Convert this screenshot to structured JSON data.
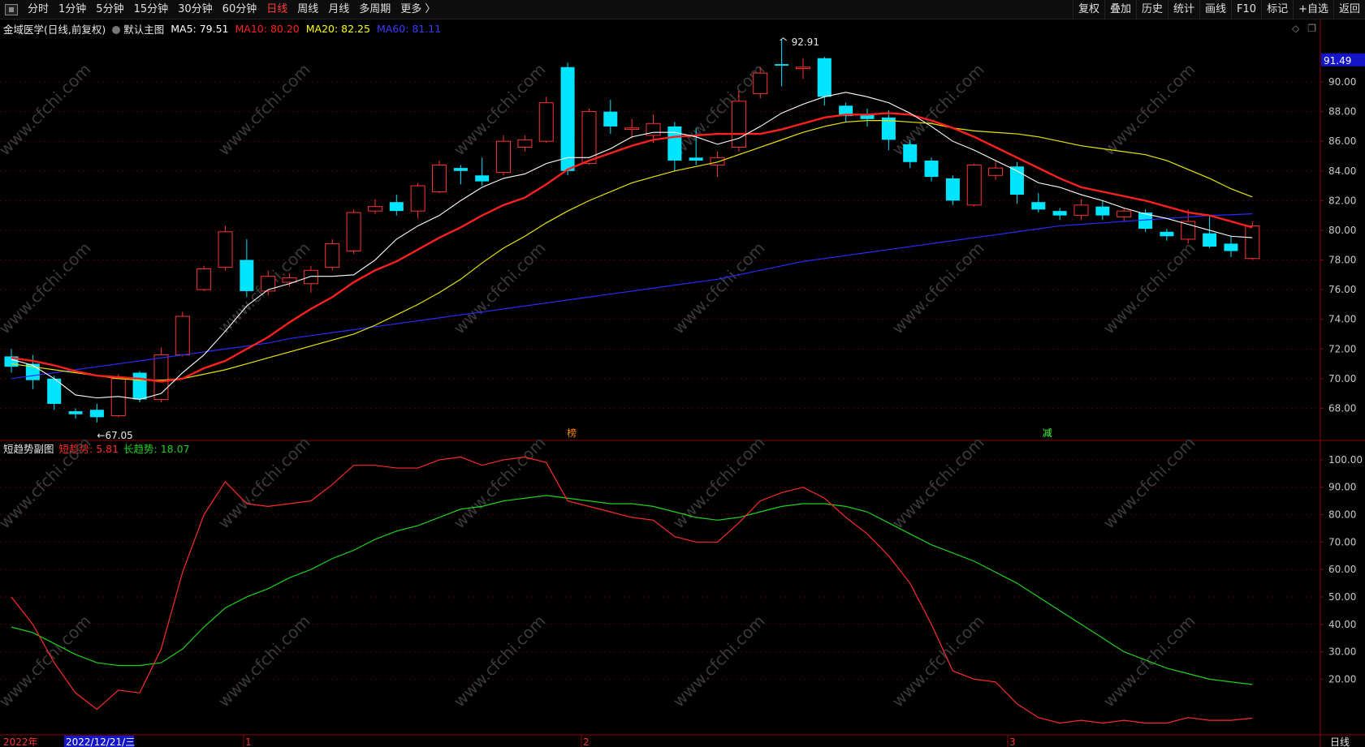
{
  "toolbar": {
    "left": [
      "分时",
      "1分钟",
      "5分钟",
      "15分钟",
      "30分钟",
      "60分钟",
      "日线",
      "周线",
      "月线",
      "多周期",
      "更多 〉"
    ],
    "active_index": 6,
    "right": [
      "复权",
      "叠加",
      "历史",
      "统计",
      "画线",
      "F10",
      "标记",
      "+自选",
      "返回"
    ]
  },
  "info": {
    "stock": "金域医学(日线,前复权)",
    "main_label": "默认主图",
    "ma": [
      {
        "label": "MA5: 79.51",
        "color": "#ffffff"
      },
      {
        "label": "MA10: 80.20",
        "color": "#ff2020"
      },
      {
        "label": "MA20: 82.25",
        "color": "#ffff00"
      },
      {
        "label": "MA60: 81.11",
        "color": "#2020ff"
      }
    ]
  },
  "sub": {
    "title": "短趋势副图",
    "short_label": "短趋势: 5.81",
    "long_label": "长趋势: 18.07"
  },
  "price_axis": {
    "ticks": [
      "90.00",
      "88.00",
      "86.00",
      "84.00",
      "82.00",
      "80.00",
      "78.00",
      "76.00",
      "74.00",
      "72.00",
      "70.00",
      "68.00"
    ],
    "current": "91.49"
  },
  "osc_axis": {
    "ticks": [
      "100.00",
      "90.00",
      "80.00",
      "70.00",
      "60.00",
      "50.00",
      "40.00",
      "30.00",
      "20.00"
    ]
  },
  "annotations": {
    "low": "←67.05",
    "high": "92.91",
    "mark1": "榜",
    "mark2": "减"
  },
  "date_axis": {
    "year": "2022年",
    "cursor": "2022/12/21/三",
    "months": [
      "1",
      "2",
      "3"
    ],
    "period": "日线"
  },
  "watermark": "www.cfchi.com",
  "colors": {
    "up": "#ff3232",
    "down": "#00e5ff",
    "ma5": "#ffffff",
    "ma10": "#ff2020",
    "ma20": "#e6e600",
    "ma60": "#2a2aff",
    "osc_short": "#ff2a2a",
    "osc_long": "#1ed21e"
  },
  "chart_data": {
    "type": "candlestick",
    "candles": [
      {
        "o": 71.5,
        "c": 70.8,
        "h": 72.0,
        "l": 70.4
      },
      {
        "o": 71.0,
        "c": 69.9,
        "h": 71.6,
        "l": 69.3
      },
      {
        "o": 70.0,
        "c": 68.3,
        "h": 70.2,
        "l": 67.9
      },
      {
        "o": 67.8,
        "c": 67.6,
        "h": 68.0,
        "l": 67.3
      },
      {
        "o": 67.9,
        "c": 67.4,
        "h": 68.3,
        "l": 67.05
      },
      {
        "o": 67.5,
        "c": 70.0,
        "h": 70.3,
        "l": 67.4
      },
      {
        "o": 70.4,
        "c": 68.6,
        "h": 70.5,
        "l": 68.4
      },
      {
        "o": 68.6,
        "c": 71.6,
        "h": 72.1,
        "l": 68.4
      },
      {
        "o": 71.6,
        "c": 74.2,
        "h": 74.5,
        "l": 71.5
      },
      {
        "o": 76.0,
        "c": 77.4,
        "h": 77.6,
        "l": 75.9
      },
      {
        "o": 77.5,
        "c": 79.9,
        "h": 80.3,
        "l": 77.3
      },
      {
        "o": 78.0,
        "c": 75.9,
        "h": 79.4,
        "l": 75.5
      },
      {
        "o": 75.9,
        "c": 76.9,
        "h": 77.3,
        "l": 75.6
      },
      {
        "o": 76.5,
        "c": 76.8,
        "h": 77.1,
        "l": 76.2
      },
      {
        "o": 76.4,
        "c": 77.3,
        "h": 77.6,
        "l": 75.8
      },
      {
        "o": 77.5,
        "c": 79.1,
        "h": 79.4,
        "l": 77.3
      },
      {
        "o": 78.6,
        "c": 81.2,
        "h": 81.4,
        "l": 78.4
      },
      {
        "o": 81.3,
        "c": 81.6,
        "h": 82.1,
        "l": 81.1
      },
      {
        "o": 81.9,
        "c": 81.3,
        "h": 82.4,
        "l": 81.0
      },
      {
        "o": 81.3,
        "c": 83.0,
        "h": 83.2,
        "l": 80.8
      },
      {
        "o": 82.6,
        "c": 84.4,
        "h": 84.7,
        "l": 82.5
      },
      {
        "o": 84.2,
        "c": 84.0,
        "h": 84.4,
        "l": 83.1
      },
      {
        "o": 83.7,
        "c": 83.3,
        "h": 84.9,
        "l": 83.0
      },
      {
        "o": 83.9,
        "c": 86.0,
        "h": 86.4,
        "l": 83.7
      },
      {
        "o": 85.6,
        "c": 86.1,
        "h": 86.4,
        "l": 85.3
      },
      {
        "o": 86.0,
        "c": 88.6,
        "h": 89.0,
        "l": 85.9
      },
      {
        "o": 91.0,
        "c": 84.0,
        "h": 91.3,
        "l": 83.7
      },
      {
        "o": 84.5,
        "c": 88.0,
        "h": 88.2,
        "l": 84.4
      },
      {
        "o": 88.0,
        "c": 87.0,
        "h": 88.8,
        "l": 86.5
      },
      {
        "o": 86.8,
        "c": 86.9,
        "h": 87.5,
        "l": 86.2
      },
      {
        "o": 86.4,
        "c": 87.2,
        "h": 87.8,
        "l": 85.9
      },
      {
        "o": 87.0,
        "c": 84.7,
        "h": 87.3,
        "l": 84.0
      },
      {
        "o": 84.9,
        "c": 84.7,
        "h": 86.9,
        "l": 84.4
      },
      {
        "o": 84.4,
        "c": 84.9,
        "h": 85.3,
        "l": 83.6
      },
      {
        "o": 85.6,
        "c": 88.7,
        "h": 89.4,
        "l": 85.3
      },
      {
        "o": 89.2,
        "c": 90.6,
        "h": 91.0,
        "l": 88.9
      },
      {
        "o": 91.2,
        "c": 91.1,
        "h": 92.91,
        "l": 89.7
      },
      {
        "o": 90.9,
        "c": 91.0,
        "h": 91.6,
        "l": 90.2
      },
      {
        "o": 91.6,
        "c": 89.0,
        "h": 91.7,
        "l": 88.4
      },
      {
        "o": 88.4,
        "c": 87.7,
        "h": 88.6,
        "l": 87.3
      },
      {
        "o": 87.8,
        "c": 87.5,
        "h": 88.2,
        "l": 87.0
      },
      {
        "o": 87.6,
        "c": 86.1,
        "h": 88.1,
        "l": 85.4
      },
      {
        "o": 85.8,
        "c": 84.6,
        "h": 86.1,
        "l": 84.2
      },
      {
        "o": 84.7,
        "c": 83.6,
        "h": 84.9,
        "l": 83.3
      },
      {
        "o": 83.5,
        "c": 82.0,
        "h": 83.7,
        "l": 81.7
      },
      {
        "o": 81.7,
        "c": 84.4,
        "h": 84.5,
        "l": 81.6
      },
      {
        "o": 83.7,
        "c": 84.2,
        "h": 84.7,
        "l": 83.4
      },
      {
        "o": 84.3,
        "c": 82.4,
        "h": 84.6,
        "l": 81.8
      },
      {
        "o": 81.9,
        "c": 81.4,
        "h": 82.5,
        "l": 81.2
      },
      {
        "o": 81.3,
        "c": 81.0,
        "h": 81.5,
        "l": 80.7
      },
      {
        "o": 81.0,
        "c": 81.7,
        "h": 82.1,
        "l": 80.7
      },
      {
        "o": 81.6,
        "c": 81.0,
        "h": 82.0,
        "l": 80.7
      },
      {
        "o": 80.9,
        "c": 81.3,
        "h": 81.5,
        "l": 80.6
      },
      {
        "o": 81.2,
        "c": 80.1,
        "h": 81.4,
        "l": 79.9
      },
      {
        "o": 79.9,
        "c": 79.6,
        "h": 80.1,
        "l": 79.3
      },
      {
        "o": 79.4,
        "c": 80.6,
        "h": 81.4,
        "l": 79.1
      },
      {
        "o": 79.8,
        "c": 78.9,
        "h": 81.0,
        "l": 78.8
      },
      {
        "o": 79.1,
        "c": 78.6,
        "h": 79.6,
        "l": 78.2
      },
      {
        "o": 78.1,
        "c": 80.3,
        "h": 80.6,
        "l": 78.0
      }
    ],
    "ma5": [
      71.3,
      70.9,
      70.0,
      68.9,
      68.7,
      68.8,
      68.6,
      69.0,
      70.4,
      71.6,
      73.2,
      74.9,
      76.0,
      76.4,
      76.9,
      76.9,
      77.0,
      78.0,
      79.4,
      80.3,
      81.0,
      82.0,
      82.9,
      83.5,
      83.8,
      84.5,
      84.9,
      84.9,
      85.5,
      86.3,
      86.6,
      86.6,
      86.3,
      85.8,
      86.2,
      87.0,
      87.9,
      88.5,
      89.0,
      89.3,
      89.0,
      88.6,
      87.9,
      87.0,
      86.0,
      85.4,
      84.7,
      84.0,
      83.2,
      82.9,
      82.4,
      82.0,
      81.5,
      81.1,
      80.8,
      80.4,
      80.0,
      79.6,
      79.5
    ],
    "ma10": [
      71.4,
      71.2,
      70.9,
      70.5,
      70.2,
      70.1,
      70.0,
      69.8,
      70.0,
      70.7,
      71.2,
      72.0,
      72.8,
      73.8,
      74.7,
      75.5,
      76.5,
      77.3,
      77.9,
      78.7,
      79.5,
      80.2,
      81.0,
      81.7,
      82.2,
      83.1,
      84.1,
      84.7,
      85.2,
      85.7,
      86.1,
      86.3,
      86.4,
      86.5,
      86.5,
      86.5,
      86.8,
      87.2,
      87.6,
      87.8,
      87.8,
      87.9,
      87.8,
      87.4,
      86.9,
      86.3,
      85.6,
      84.9,
      84.2,
      83.5,
      82.9,
      82.6,
      82.3,
      82.0,
      81.6,
      81.2,
      81.0,
      80.6,
      80.2
    ],
    "ma20": [
      71.0,
      70.8,
      70.6,
      70.4,
      70.2,
      70.0,
      69.9,
      69.9,
      70.0,
      70.3,
      70.6,
      71.0,
      71.4,
      71.8,
      72.2,
      72.6,
      73.0,
      73.6,
      74.3,
      75.0,
      75.8,
      76.7,
      77.8,
      78.8,
      79.6,
      80.5,
      81.3,
      82.0,
      82.6,
      83.2,
      83.6,
      84.0,
      84.3,
      84.6,
      85.1,
      85.6,
      86.1,
      86.6,
      87.0,
      87.3,
      87.4,
      87.4,
      87.3,
      87.2,
      86.9,
      86.7,
      86.6,
      86.5,
      86.3,
      86.0,
      85.7,
      85.5,
      85.3,
      85.1,
      84.7,
      84.1,
      83.5,
      82.8,
      82.25
    ],
    "ma60": [
      70.0,
      70.2,
      70.4,
      70.6,
      70.8,
      71.0,
      71.2,
      71.4,
      71.6,
      71.8,
      72.0,
      72.2,
      72.4,
      72.7,
      72.9,
      73.1,
      73.3,
      73.5,
      73.7,
      73.9,
      74.1,
      74.3,
      74.5,
      74.7,
      74.9,
      75.1,
      75.3,
      75.5,
      75.7,
      75.9,
      76.1,
      76.3,
      76.5,
      76.7,
      77.0,
      77.3,
      77.6,
      77.9,
      78.1,
      78.3,
      78.5,
      78.7,
      78.9,
      79.1,
      79.3,
      79.5,
      79.7,
      79.9,
      80.1,
      80.3,
      80.4,
      80.5,
      80.6,
      80.7,
      80.8,
      80.9,
      81.0,
      81.05,
      81.11
    ],
    "short_trend": [
      50,
      40,
      26,
      15,
      9,
      16,
      15,
      31,
      59,
      80,
      92,
      84,
      83,
      84,
      85,
      91,
      98,
      98,
      97,
      97,
      100,
      101,
      98,
      100,
      101,
      99,
      85,
      83,
      81,
      79,
      78,
      72,
      70,
      70,
      77,
      85,
      88,
      90,
      86,
      79,
      73,
      65,
      55,
      40,
      23,
      20,
      19,
      11,
      6,
      4,
      5,
      4,
      5,
      4,
      4,
      6,
      5,
      5,
      5.81
    ],
    "long_trend": [
      39,
      37,
      33,
      29,
      26,
      25,
      25,
      26,
      31,
      39,
      46,
      50,
      53,
      57,
      60,
      64,
      67,
      71,
      74,
      76,
      79,
      82,
      83,
      85,
      86,
      87,
      86,
      85,
      84,
      84,
      83,
      81,
      79,
      78,
      79,
      81,
      83,
      84,
      84,
      83,
      81,
      77,
      73,
      69,
      66,
      63,
      59,
      55,
      50,
      45,
      40,
      35,
      30,
      27,
      24,
      22,
      20,
      19,
      18.07
    ]
  }
}
